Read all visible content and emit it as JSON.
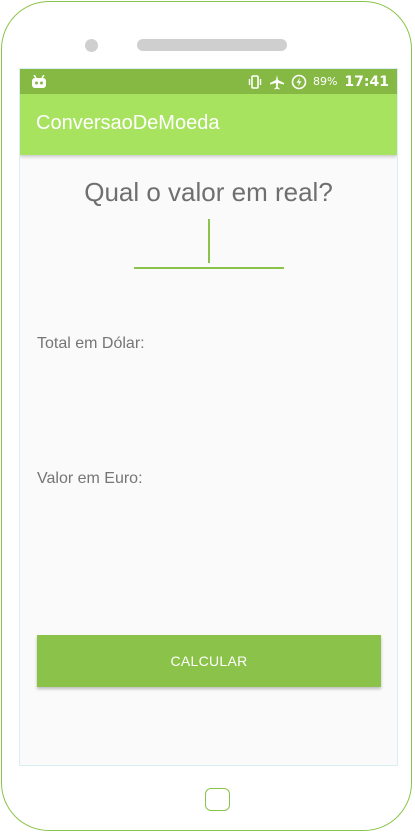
{
  "status_bar": {
    "left_icon": "android-debug-icon",
    "icons": [
      "vibrate-icon",
      "airplane-mode-icon",
      "battery-charging-icon"
    ],
    "battery": "89%",
    "time": "17:41"
  },
  "app_bar": {
    "title": "ConversaoDeMoeda"
  },
  "main": {
    "question": "Qual o valor em real?",
    "input_value": "",
    "dollar_label": "Total em Dólar:",
    "euro_label": "Valor em Euro:",
    "calculate_label": "CALCULAR"
  },
  "colors": {
    "status_bar": "#86b944",
    "app_bar": "#a8e35f",
    "accent": "#8bc34a",
    "text": "#757575"
  }
}
